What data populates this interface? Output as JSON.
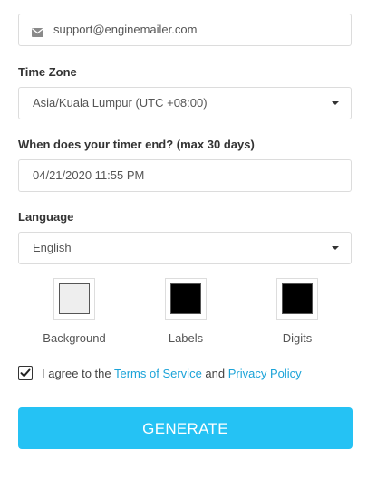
{
  "email": {
    "value": "support@enginemailer.com",
    "icon": "envelope-icon"
  },
  "time_zone": {
    "label": "Time Zone",
    "selected": "Asia/Kuala Lumpur (UTC +08:00)"
  },
  "timer_end": {
    "label": "When does your timer end? (max 30 days)",
    "value": "04/21/2020 11:55 PM"
  },
  "language": {
    "label": "Language",
    "selected": "English"
  },
  "colors": [
    {
      "label": "Background",
      "color": "#eeeeee"
    },
    {
      "label": "Labels",
      "color": "#000000"
    },
    {
      "label": "Digits",
      "color": "#000000"
    }
  ],
  "agreement": {
    "checked": true,
    "prefix": "I agree to the ",
    "terms_link": "Terms of Service",
    "middle": " and ",
    "privacy_link": "Privacy Policy"
  },
  "generate_button": {
    "label": "GENERATE",
    "color": "#25c2f4"
  }
}
